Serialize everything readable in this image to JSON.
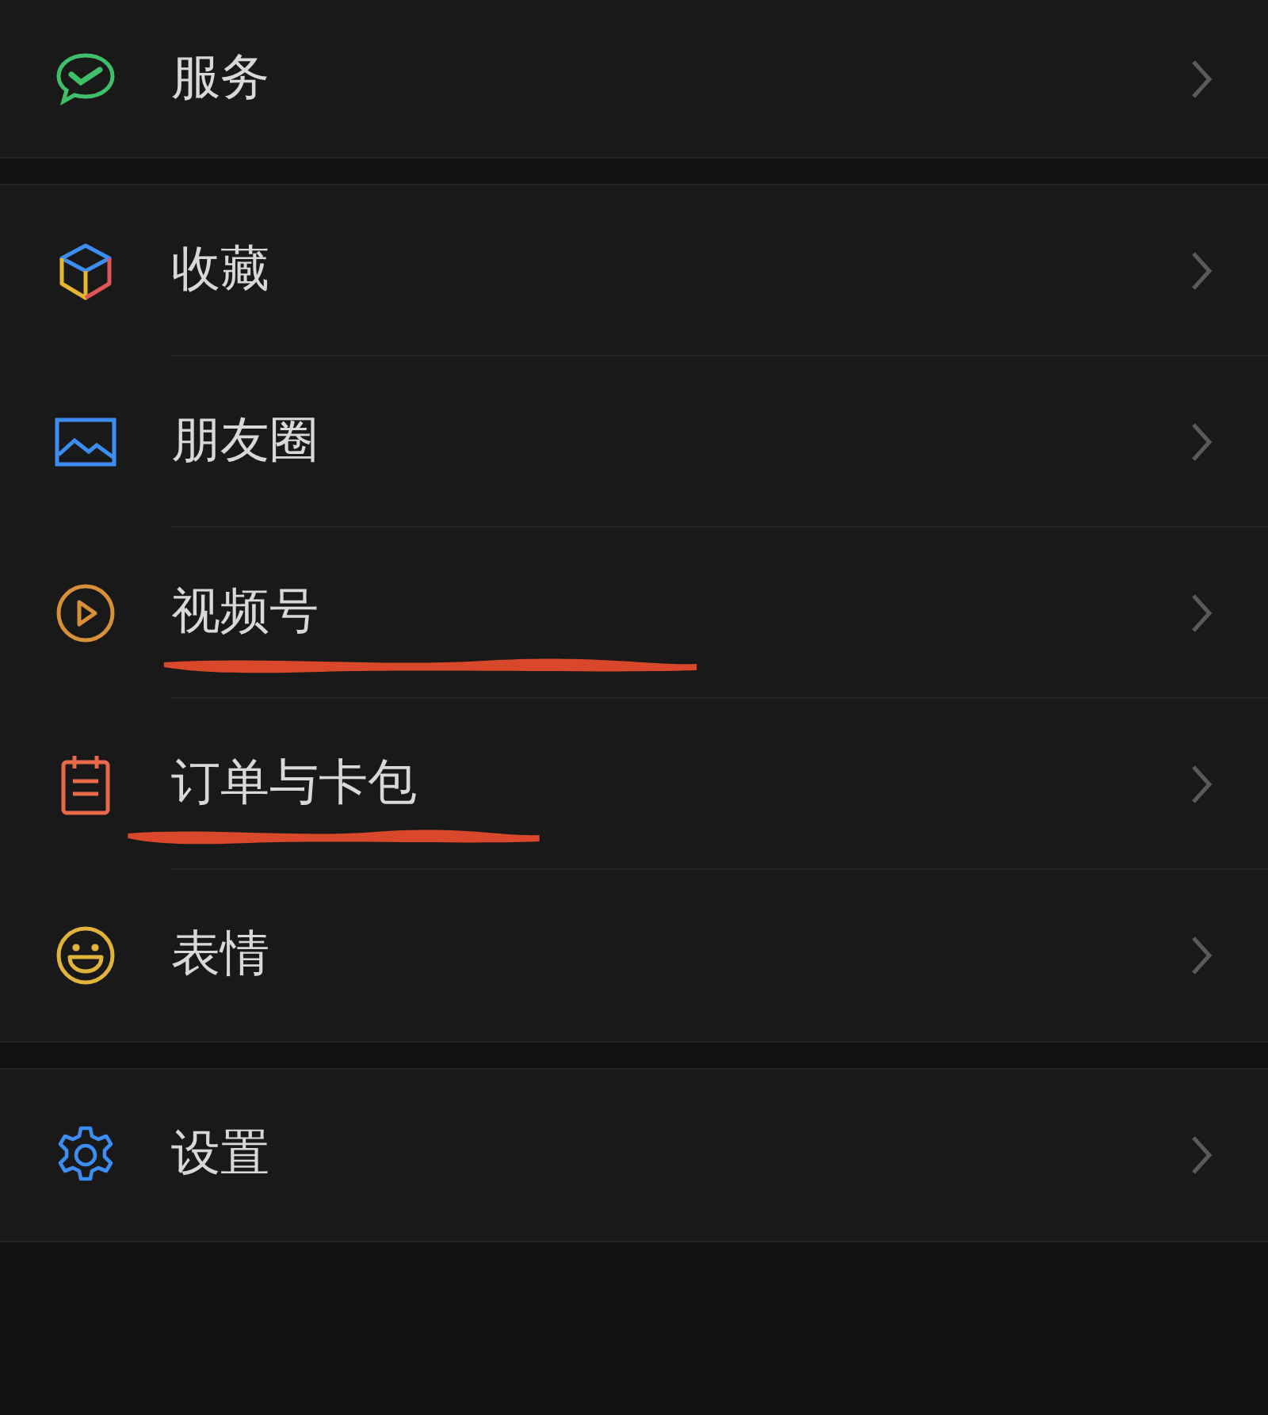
{
  "groups": [
    {
      "items": [
        {
          "label": "服务",
          "underlined": false
        }
      ]
    },
    {
      "items": [
        {
          "label": "收藏",
          "underlined": false
        },
        {
          "label": "朋友圈",
          "underlined": false
        },
        {
          "label": "视频号",
          "underlined": true
        },
        {
          "label": "订单与卡包",
          "underlined": true
        },
        {
          "label": "表情",
          "underlined": false
        }
      ]
    },
    {
      "items": [
        {
          "label": "设置",
          "underlined": false
        }
      ]
    }
  ]
}
